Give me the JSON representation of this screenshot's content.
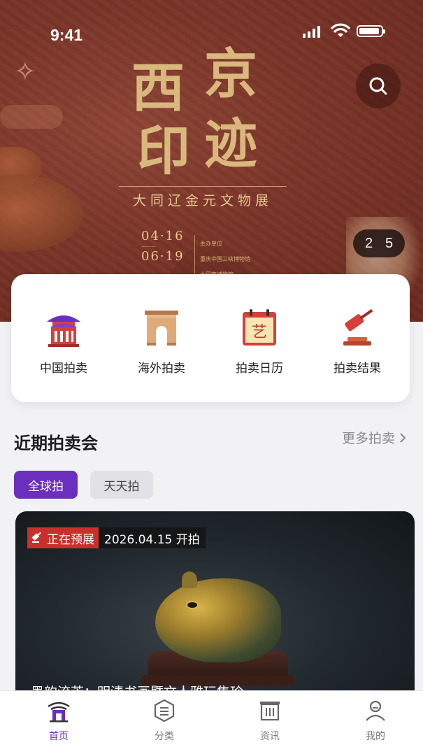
{
  "status_bar": {
    "time": "9:41"
  },
  "banner": {
    "title_chars": [
      "西",
      "京",
      "印",
      "迹"
    ],
    "subtitle": "大同辽金元文物展",
    "date_start": "04·16",
    "date_end": "06·19",
    "organizer_label": "主办单位",
    "organizer_1": "重庆中国三峡博物馆",
    "organizer_2": "大同市博物馆",
    "pager_current": "2",
    "pager_total": "5"
  },
  "categories": [
    {
      "label": "中国拍卖",
      "icon": "chinese-pavilion-icon"
    },
    {
      "label": "海外拍卖",
      "icon": "arch-gate-icon"
    },
    {
      "label": "拍卖日历",
      "icon": "calendar-icon"
    },
    {
      "label": "拍卖结果",
      "icon": "gavel-icon"
    }
  ],
  "section": {
    "title": "近期拍卖会",
    "more_label": "更多拍卖"
  },
  "tabs": [
    {
      "label": "全球拍",
      "active": true
    },
    {
      "label": "天天拍",
      "active": false
    }
  ],
  "auction": {
    "status": "正在预展",
    "date_text": "2026.04.15 开拍",
    "title": "墨韵流芳：明清书画暨文人雅玩集珍"
  },
  "bottom_nav": [
    {
      "label": "首页",
      "active": true
    },
    {
      "label": "分类",
      "active": false
    },
    {
      "label": "资讯",
      "active": false
    },
    {
      "label": "我的",
      "active": false
    }
  ],
  "colors": {
    "accent": "#6b2fc0",
    "badge_red": "#c9302c",
    "banner": "#7a3428"
  }
}
